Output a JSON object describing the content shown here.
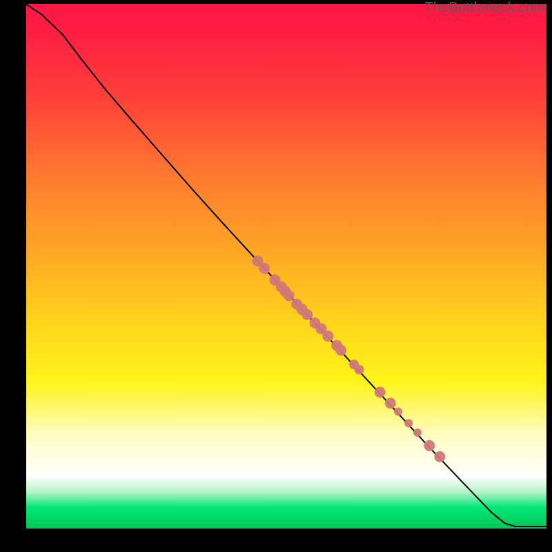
{
  "watermark": "TheBottleneck.com",
  "chart_data": {
    "type": "line",
    "title": "",
    "xlabel": "",
    "ylabel": "",
    "xlim": [
      0,
      1
    ],
    "ylim": [
      0,
      1
    ],
    "grid": false,
    "legend": false,
    "curve": [
      {
        "x": 0.0,
        "y": 1.0
      },
      {
        "x": 0.03,
        "y": 0.98
      },
      {
        "x": 0.07,
        "y": 0.942
      },
      {
        "x": 0.11,
        "y": 0.89
      },
      {
        "x": 0.15,
        "y": 0.84
      },
      {
        "x": 0.2,
        "y": 0.782
      },
      {
        "x": 0.26,
        "y": 0.714
      },
      {
        "x": 0.32,
        "y": 0.646
      },
      {
        "x": 0.38,
        "y": 0.58
      },
      {
        "x": 0.445,
        "y": 0.51
      },
      {
        "x": 0.51,
        "y": 0.44
      },
      {
        "x": 0.575,
        "y": 0.37
      },
      {
        "x": 0.64,
        "y": 0.3
      },
      {
        "x": 0.705,
        "y": 0.23
      },
      {
        "x": 0.77,
        "y": 0.16
      },
      {
        "x": 0.835,
        "y": 0.092
      },
      {
        "x": 0.895,
        "y": 0.03
      },
      {
        "x": 0.92,
        "y": 0.01
      },
      {
        "x": 0.94,
        "y": 0.004
      },
      {
        "x": 1.0,
        "y": 0.004
      }
    ],
    "points": [
      {
        "x": 0.445,
        "y": 0.51,
        "r": 8
      },
      {
        "x": 0.458,
        "y": 0.496,
        "r": 8
      },
      {
        "x": 0.478,
        "y": 0.474,
        "r": 8
      },
      {
        "x": 0.49,
        "y": 0.461,
        "r": 8
      },
      {
        "x": 0.498,
        "y": 0.452,
        "r": 8
      },
      {
        "x": 0.505,
        "y": 0.444,
        "r": 8
      },
      {
        "x": 0.52,
        "y": 0.428,
        "r": 8
      },
      {
        "x": 0.53,
        "y": 0.418,
        "r": 8
      },
      {
        "x": 0.54,
        "y": 0.408,
        "r": 8
      },
      {
        "x": 0.555,
        "y": 0.392,
        "r": 8
      },
      {
        "x": 0.567,
        "y": 0.381,
        "r": 8
      },
      {
        "x": 0.58,
        "y": 0.367,
        "r": 8
      },
      {
        "x": 0.597,
        "y": 0.349,
        "r": 8
      },
      {
        "x": 0.605,
        "y": 0.34,
        "r": 8
      },
      {
        "x": 0.63,
        "y": 0.313,
        "r": 7
      },
      {
        "x": 0.64,
        "y": 0.303,
        "r": 7
      },
      {
        "x": 0.68,
        "y": 0.26,
        "r": 8
      },
      {
        "x": 0.7,
        "y": 0.239,
        "r": 8
      },
      {
        "x": 0.715,
        "y": 0.223,
        "r": 6
      },
      {
        "x": 0.735,
        "y": 0.201,
        "r": 6
      },
      {
        "x": 0.752,
        "y": 0.183,
        "r": 6
      },
      {
        "x": 0.775,
        "y": 0.158,
        "r": 8
      },
      {
        "x": 0.795,
        "y": 0.137,
        "r": 8
      }
    ]
  }
}
